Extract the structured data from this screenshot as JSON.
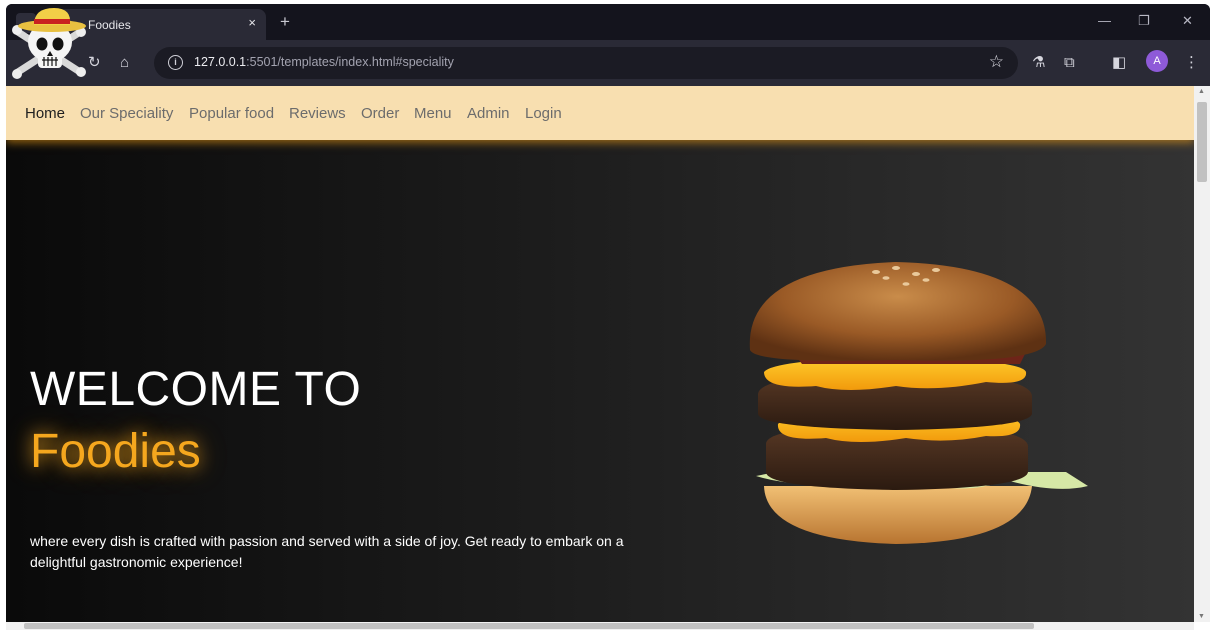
{
  "browser": {
    "tab_title": "Foodies",
    "tab_close": "×",
    "new_tab": "+",
    "url_host": "127.0.0.1",
    "url_rest": ":5501/templates/index.html#speciality",
    "profile_initial": "A",
    "icons": [
      "tab-search-icon",
      "reload-icon",
      "home-icon",
      "site-info-icon",
      "bookmark-star-icon",
      "extension-icon",
      "puzzle-icon",
      "side-panel-icon",
      "menu-icon",
      "minimize-icon",
      "restore-icon",
      "close-icon"
    ]
  },
  "nav": {
    "items": [
      {
        "label": "Home",
        "active": true
      },
      {
        "label": "Our Speciality",
        "active": false
      },
      {
        "label": "Popular food",
        "active": false
      },
      {
        "label": "Reviews",
        "active": false
      },
      {
        "label": "Order",
        "active": false
      },
      {
        "label": "Menu",
        "active": false
      },
      {
        "label": "Admin",
        "active": false
      },
      {
        "label": "Login",
        "active": false
      }
    ]
  },
  "hero": {
    "line1": "WELCOME TO",
    "line2": "Foodies",
    "description": "where every dish is crafted with passion and served with a side of joy. Get ready to embark on a delightful gastronomic experience!"
  },
  "colors": {
    "navbar_bg": "#f8dfb0",
    "accent": "#f5a71e",
    "hero_bg": "#1a1a1a",
    "chrome_bg": "#1f1f2b"
  }
}
